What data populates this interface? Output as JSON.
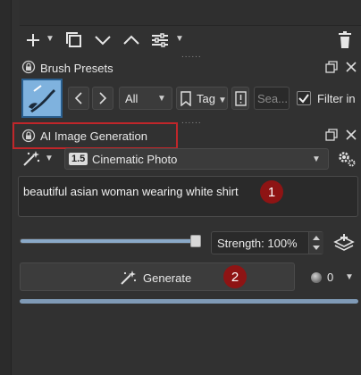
{
  "toolbar": {
    "handle": "......"
  },
  "brush_presets": {
    "title": "Brush Presets",
    "filter_all": "All",
    "tag": "Tag",
    "search_placeholder": "Sea...",
    "filter_label": "Filter in",
    "filter_checked": true,
    "handle": "......"
  },
  "ai_panel": {
    "title": "AI Image Generation",
    "model_badge": "1.5",
    "style": "Cinematic Photo",
    "prompt": "beautiful asian woman wearing white shirt",
    "strength_label": "Strength: 100%",
    "strength_value": 1.0,
    "generate_label": "Generate",
    "queue_count": "0",
    "badge_1": "1",
    "badge_2": "2",
    "highlight_color": "#c0262a"
  }
}
